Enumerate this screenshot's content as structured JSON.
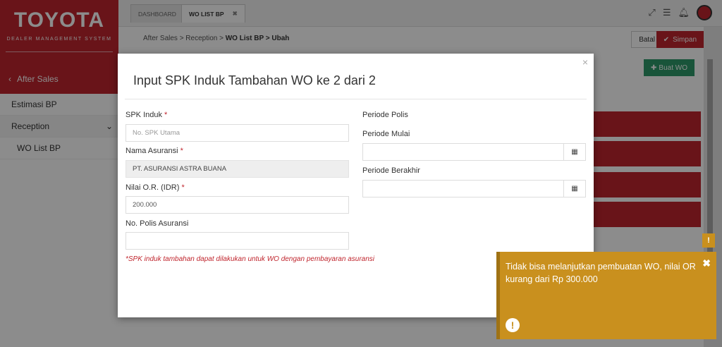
{
  "brand": {
    "logo": "TOYOTA",
    "subtitle": "DEALER MANAGEMENT SYSTEM"
  },
  "sidebar": {
    "back_label": "After Sales",
    "items": [
      {
        "label": "Estimasi BP"
      },
      {
        "label": "Reception"
      },
      {
        "label": "WO List BP"
      }
    ]
  },
  "tabs": [
    {
      "label": "DASHBOARD"
    },
    {
      "label": "WO LIST BP",
      "close": "✖"
    }
  ],
  "breadcrumb": {
    "path": "After Sales > Reception > ",
    "current": "WO List BP > Ubah"
  },
  "toolbar": {
    "batal_label": "Batal",
    "simpan_label": "Simpan",
    "buat_wo_label": "Buat WO"
  },
  "modal": {
    "title": "Input SPK Induk Tambahan WO ke 2 dari 2",
    "close": "×",
    "spk_induk": {
      "label": "SPK Induk",
      "required": "*",
      "placeholder": "No. SPK Utama"
    },
    "nama_asuransi": {
      "label": "Nama Asuransi",
      "required": "*",
      "value": "PT. ASURANSI ASTRA BUANA"
    },
    "nilai_or": {
      "label": "Nilai O.R. (IDR)",
      "required": "*",
      "value": "200.000"
    },
    "no_polis": {
      "label": "No. Polis Asuransi",
      "value": ""
    },
    "periode_polis": {
      "label": "Periode Polis"
    },
    "periode_mulai": {
      "label": "Periode Mulai",
      "value": ""
    },
    "periode_berakhir": {
      "label": "Periode Berakhir",
      "value": ""
    },
    "note": "*SPK induk tambahan dapat dilakukan untuk WO dengan pembayaran asuransi"
  },
  "toast": {
    "message": "Tidak bisa melanjutkan pembuatan WO, nilai OR kurang dari Rp 300.000",
    "close": "✖",
    "icon": "!"
  },
  "colors": {
    "brand_red": "#c0262e",
    "warning": "#c9901e",
    "success": "#2e9a6a"
  }
}
